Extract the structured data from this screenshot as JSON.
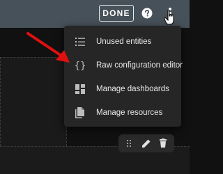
{
  "toolbar": {
    "done_label": "DONE",
    "help_icon": "help-circle-icon",
    "more_icon": "more-vertical-icon"
  },
  "menu": {
    "items": [
      {
        "label": "Unused entities",
        "icon": "list-icon"
      },
      {
        "label": "Raw configuration editor",
        "icon": "code-braces-icon"
      },
      {
        "label": "Manage dashboards",
        "icon": "dashboard-icon"
      },
      {
        "label": "Manage resources",
        "icon": "file-multiple-icon"
      }
    ]
  },
  "card_toolbar": {
    "icons": [
      "drag-handle-icon",
      "pencil-icon",
      "delete-icon"
    ]
  },
  "colors": {
    "topbar": "#475159",
    "menu_bg": "#262626",
    "arrow": "#e01010",
    "background": "#111111"
  }
}
